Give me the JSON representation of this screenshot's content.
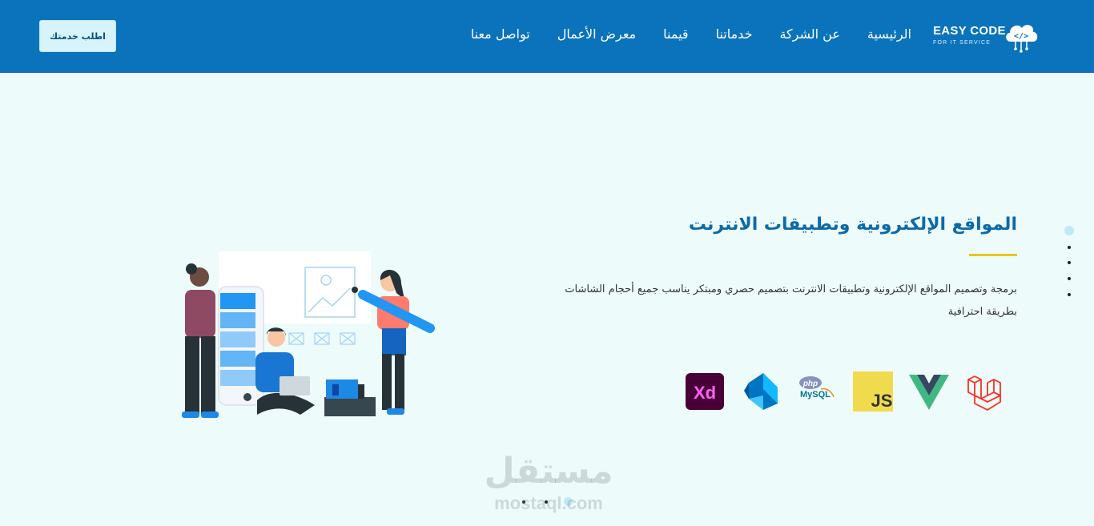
{
  "header": {
    "cta_label": "اطلب خدمتك",
    "nav": [
      {
        "label": "الرئيسية"
      },
      {
        "label": "عن الشركة"
      },
      {
        "label": "خدماتنا"
      },
      {
        "label": "قيمنا"
      },
      {
        "label": "معرض الأعمال"
      },
      {
        "label": "تواصل معنا"
      }
    ],
    "logo": {
      "main": "EASY CODE",
      "sub": "FOR IT SERVICE",
      "icon": "cloud-code-icon"
    }
  },
  "hero": {
    "title": "المواقع الإلكترونية وتطبيقات الانترنت",
    "description": "برمجة وتصميم المواقع الإلكترونية وتطبيقات الانترنت بتصميم حصري ومبتكر يناسب جميع أحجام الشاشات بطريقة احترافية",
    "tech_icons": [
      "laravel-icon",
      "vue-icon",
      "javascript-icon",
      "php-mysql-icon",
      "dart-icon",
      "adobe-xd-icon"
    ],
    "tech_labels": {
      "js": "JS",
      "xd": "Xd",
      "php": "php",
      "mysql": "MySQL"
    }
  },
  "watermark": {
    "arabic": "مستقل",
    "latin": "mostaql.com"
  },
  "colors": {
    "header_bg": "#0b73bb",
    "page_bg": "#eefbfb",
    "title": "#0b6aa8",
    "accent": "#f0c419"
  }
}
